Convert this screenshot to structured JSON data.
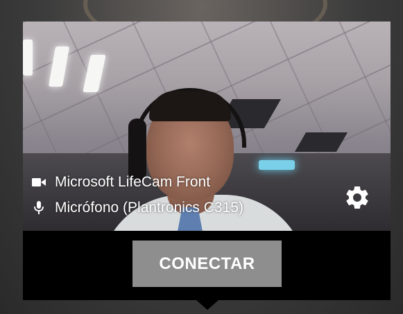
{
  "camera": {
    "icon": "videocam-icon",
    "label": "Microsoft LifeCam Front"
  },
  "microphone": {
    "icon": "mic-icon",
    "label": "Micrófono (Plantronics C315)"
  },
  "settings": {
    "icon": "gear-icon"
  },
  "actions": {
    "connect_label": "CONECTAR"
  },
  "colors": {
    "panel_bg": "#000000",
    "button_bg": "#8e8e8e",
    "text": "#ffffff"
  }
}
